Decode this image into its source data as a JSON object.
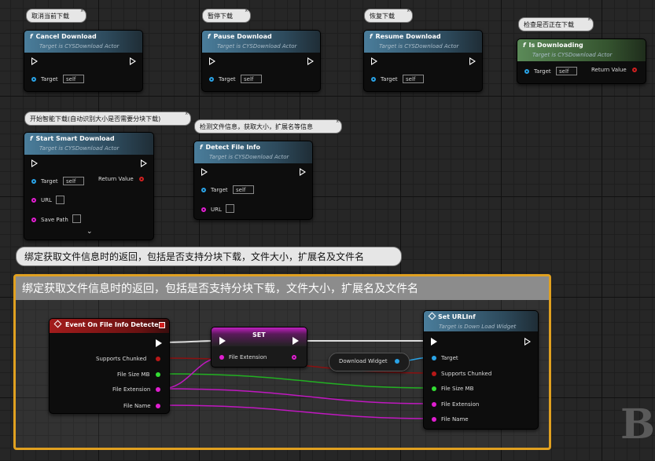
{
  "comments_small": {
    "cancel": "取消当前下载",
    "pause": "暂停下载",
    "resume": "恢复下载",
    "isdl": "检查是否正在下载",
    "start": "开始智能下载(自动识别大小是否需要分块下载)",
    "detect": "检测文件信息，获取大小，扩展名等信息"
  },
  "close_glyph": "x",
  "big_bubble": "绑定获取文件信息时的返回，包括是否支持分块下载，文件大小，扩展名及文件名",
  "comment_box_title": "绑定获取文件信息时的返回，包括是否支持分块下载，文件大小，扩展名及文件名",
  "fn_glyph": "f",
  "target_sub": "Target is CYSDownload Actor",
  "self_value": "self",
  "nodes": {
    "cancel": {
      "title": "Cancel Download",
      "target": "Target"
    },
    "pause": {
      "title": "Pause Download",
      "target": "Target"
    },
    "resume": {
      "title": "Resume Download",
      "target": "Target"
    },
    "isdl": {
      "title": "Is Downloading",
      "target": "Target",
      "ret": "Return Value"
    },
    "start": {
      "title": "Start Smart Download",
      "target": "Target",
      "ret": "Return Value",
      "url": "URL",
      "save": "Save Path",
      "expand": "⌄"
    },
    "detect": {
      "title": "Detect File Info",
      "target": "Target",
      "url": "URL"
    },
    "event": {
      "title": "Event On File Info Detected",
      "p1": "Supports Chunked",
      "p2": "File Size MB",
      "p3": "File Extension",
      "p4": "File Name"
    },
    "set": {
      "title": "SET",
      "p1": "File Extension"
    },
    "getter": {
      "title": "Download Widget"
    },
    "seturl": {
      "title": "Set URLInf",
      "sub": "Target is Down Load Widget",
      "p0": "Target",
      "p1": "Supports Chunked",
      "p2": "File Size MB",
      "p3": "File Extension",
      "p4": "File Name"
    }
  },
  "watermark": "BI",
  "colors": {
    "exec": "#ffffff",
    "object": "#2aa3e6",
    "string": "#e01ed0",
    "bool": "#b81818",
    "float": "#33dd33",
    "comment_border": "#e0a020"
  }
}
